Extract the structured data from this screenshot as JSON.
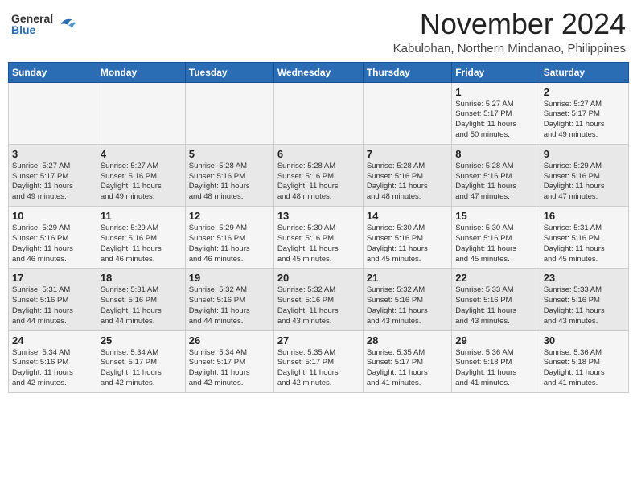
{
  "header": {
    "logo_general": "General",
    "logo_blue": "Blue",
    "month_title": "November 2024",
    "location": "Kabulohan, Northern Mindanao, Philippines"
  },
  "weekdays": [
    "Sunday",
    "Monday",
    "Tuesday",
    "Wednesday",
    "Thursday",
    "Friday",
    "Saturday"
  ],
  "weeks": [
    [
      {
        "day": "",
        "info": ""
      },
      {
        "day": "",
        "info": ""
      },
      {
        "day": "",
        "info": ""
      },
      {
        "day": "",
        "info": ""
      },
      {
        "day": "",
        "info": ""
      },
      {
        "day": "1",
        "info": "Sunrise: 5:27 AM\nSunset: 5:17 PM\nDaylight: 11 hours\nand 50 minutes."
      },
      {
        "day": "2",
        "info": "Sunrise: 5:27 AM\nSunset: 5:17 PM\nDaylight: 11 hours\nand 49 minutes."
      }
    ],
    [
      {
        "day": "3",
        "info": "Sunrise: 5:27 AM\nSunset: 5:17 PM\nDaylight: 11 hours\nand 49 minutes."
      },
      {
        "day": "4",
        "info": "Sunrise: 5:27 AM\nSunset: 5:16 PM\nDaylight: 11 hours\nand 49 minutes."
      },
      {
        "day": "5",
        "info": "Sunrise: 5:28 AM\nSunset: 5:16 PM\nDaylight: 11 hours\nand 48 minutes."
      },
      {
        "day": "6",
        "info": "Sunrise: 5:28 AM\nSunset: 5:16 PM\nDaylight: 11 hours\nand 48 minutes."
      },
      {
        "day": "7",
        "info": "Sunrise: 5:28 AM\nSunset: 5:16 PM\nDaylight: 11 hours\nand 48 minutes."
      },
      {
        "day": "8",
        "info": "Sunrise: 5:28 AM\nSunset: 5:16 PM\nDaylight: 11 hours\nand 47 minutes."
      },
      {
        "day": "9",
        "info": "Sunrise: 5:29 AM\nSunset: 5:16 PM\nDaylight: 11 hours\nand 47 minutes."
      }
    ],
    [
      {
        "day": "10",
        "info": "Sunrise: 5:29 AM\nSunset: 5:16 PM\nDaylight: 11 hours\nand 46 minutes."
      },
      {
        "day": "11",
        "info": "Sunrise: 5:29 AM\nSunset: 5:16 PM\nDaylight: 11 hours\nand 46 minutes."
      },
      {
        "day": "12",
        "info": "Sunrise: 5:29 AM\nSunset: 5:16 PM\nDaylight: 11 hours\nand 46 minutes."
      },
      {
        "day": "13",
        "info": "Sunrise: 5:30 AM\nSunset: 5:16 PM\nDaylight: 11 hours\nand 45 minutes."
      },
      {
        "day": "14",
        "info": "Sunrise: 5:30 AM\nSunset: 5:16 PM\nDaylight: 11 hours\nand 45 minutes."
      },
      {
        "day": "15",
        "info": "Sunrise: 5:30 AM\nSunset: 5:16 PM\nDaylight: 11 hours\nand 45 minutes."
      },
      {
        "day": "16",
        "info": "Sunrise: 5:31 AM\nSunset: 5:16 PM\nDaylight: 11 hours\nand 45 minutes."
      }
    ],
    [
      {
        "day": "17",
        "info": "Sunrise: 5:31 AM\nSunset: 5:16 PM\nDaylight: 11 hours\nand 44 minutes."
      },
      {
        "day": "18",
        "info": "Sunrise: 5:31 AM\nSunset: 5:16 PM\nDaylight: 11 hours\nand 44 minutes."
      },
      {
        "day": "19",
        "info": "Sunrise: 5:32 AM\nSunset: 5:16 PM\nDaylight: 11 hours\nand 44 minutes."
      },
      {
        "day": "20",
        "info": "Sunrise: 5:32 AM\nSunset: 5:16 PM\nDaylight: 11 hours\nand 43 minutes."
      },
      {
        "day": "21",
        "info": "Sunrise: 5:32 AM\nSunset: 5:16 PM\nDaylight: 11 hours\nand 43 minutes."
      },
      {
        "day": "22",
        "info": "Sunrise: 5:33 AM\nSunset: 5:16 PM\nDaylight: 11 hours\nand 43 minutes."
      },
      {
        "day": "23",
        "info": "Sunrise: 5:33 AM\nSunset: 5:16 PM\nDaylight: 11 hours\nand 43 minutes."
      }
    ],
    [
      {
        "day": "24",
        "info": "Sunrise: 5:34 AM\nSunset: 5:16 PM\nDaylight: 11 hours\nand 42 minutes."
      },
      {
        "day": "25",
        "info": "Sunrise: 5:34 AM\nSunset: 5:17 PM\nDaylight: 11 hours\nand 42 minutes."
      },
      {
        "day": "26",
        "info": "Sunrise: 5:34 AM\nSunset: 5:17 PM\nDaylight: 11 hours\nand 42 minutes."
      },
      {
        "day": "27",
        "info": "Sunrise: 5:35 AM\nSunset: 5:17 PM\nDaylight: 11 hours\nand 42 minutes."
      },
      {
        "day": "28",
        "info": "Sunrise: 5:35 AM\nSunset: 5:17 PM\nDaylight: 11 hours\nand 41 minutes."
      },
      {
        "day": "29",
        "info": "Sunrise: 5:36 AM\nSunset: 5:18 PM\nDaylight: 11 hours\nand 41 minutes."
      },
      {
        "day": "30",
        "info": "Sunrise: 5:36 AM\nSunset: 5:18 PM\nDaylight: 11 hours\nand 41 minutes."
      }
    ]
  ]
}
